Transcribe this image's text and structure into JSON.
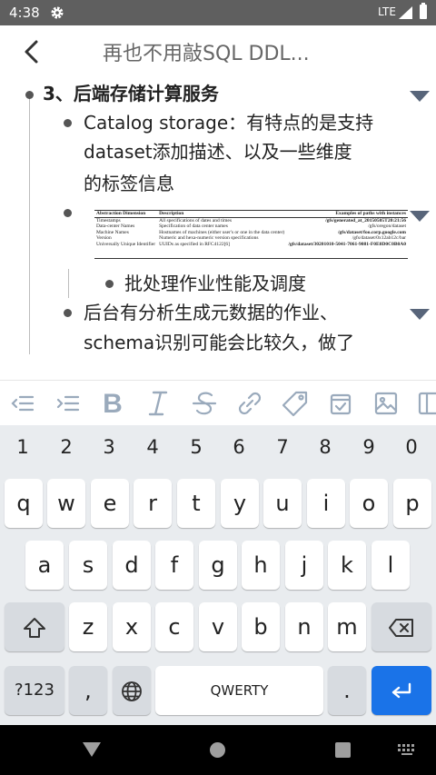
{
  "status_bar": {
    "time": "4:38",
    "network": "LTE",
    "settings_icon": "gear-icon",
    "signal_icon": "signal-icon",
    "battery_icon": "battery-icon"
  },
  "app_bar": {
    "back_icon": "arrow-back-icon",
    "title": "再也不用敲SQL DDL..."
  },
  "outline": {
    "heading": "3、后端存储计算服务",
    "items": [
      {
        "line1": "Catalog storage：有特点的是支持",
        "line2": "dataset添加描述、以及一些维度",
        "line3": "的标签信息"
      },
      {
        "sub_item": "批处理作业性能及调度"
      },
      {
        "line1": "后台有分析生成元数据的作业、",
        "line2": "schema识别可能会比较久，做了"
      }
    ],
    "embedded_table": {
      "headers": [
        "Abstraction Dimension",
        "Description",
        "Examples of paths with instances"
      ],
      "rows": [
        [
          "Timestamps",
          "All specifications of dates and times",
          "/gfs/generated_at_20150505T20:21:56"
        ],
        [
          "Data-center Names",
          "Specification of data center names",
          "/gfs/oregon/dataset"
        ],
        [
          "Machine Names",
          "Hostnames of machines (either user's or one in the data center)",
          "/gfs/dataset/foo.corp.google.com"
        ],
        [
          "Version",
          "Numeric and hexa-numeric version specifications",
          "/gfs/dataset/0x12ab12c/bar"
        ],
        [
          "Universally Unique Identifier",
          "UUIDs as specified in RFC4122[6]",
          "/gfs/dataset/30201010-5041-7061-9081-F0E0D0C0B0A0"
        ]
      ]
    }
  },
  "toolbar": {
    "icons": [
      "outdent-icon",
      "indent-icon",
      "bold-icon",
      "italic-icon",
      "strikethrough-icon",
      "link-icon",
      "tag-icon",
      "checkbox-icon",
      "image-icon",
      "table-icon"
    ]
  },
  "keyboard": {
    "numbers": [
      "1",
      "2",
      "3",
      "4",
      "5",
      "6",
      "7",
      "8",
      "9",
      "0"
    ],
    "row1": [
      "q",
      "w",
      "e",
      "r",
      "t",
      "y",
      "u",
      "i",
      "o",
      "p"
    ],
    "row2": [
      "a",
      "s",
      "d",
      "f",
      "g",
      "h",
      "j",
      "k",
      "l"
    ],
    "row3": [
      "z",
      "x",
      "c",
      "v",
      "b",
      "n",
      "m"
    ],
    "symbols_label": "?123",
    "comma": ",",
    "space_label": "QWERTY",
    "period": ".",
    "colors": {
      "enter": "#1a73e8",
      "keyboard_bg": "#e9ecef"
    }
  },
  "nav_bar": {
    "back_icon": "nav-back-icon",
    "home_icon": "nav-home-icon",
    "recents_icon": "nav-recents-icon",
    "keyboard_icon": "keyboard-switch-icon"
  }
}
